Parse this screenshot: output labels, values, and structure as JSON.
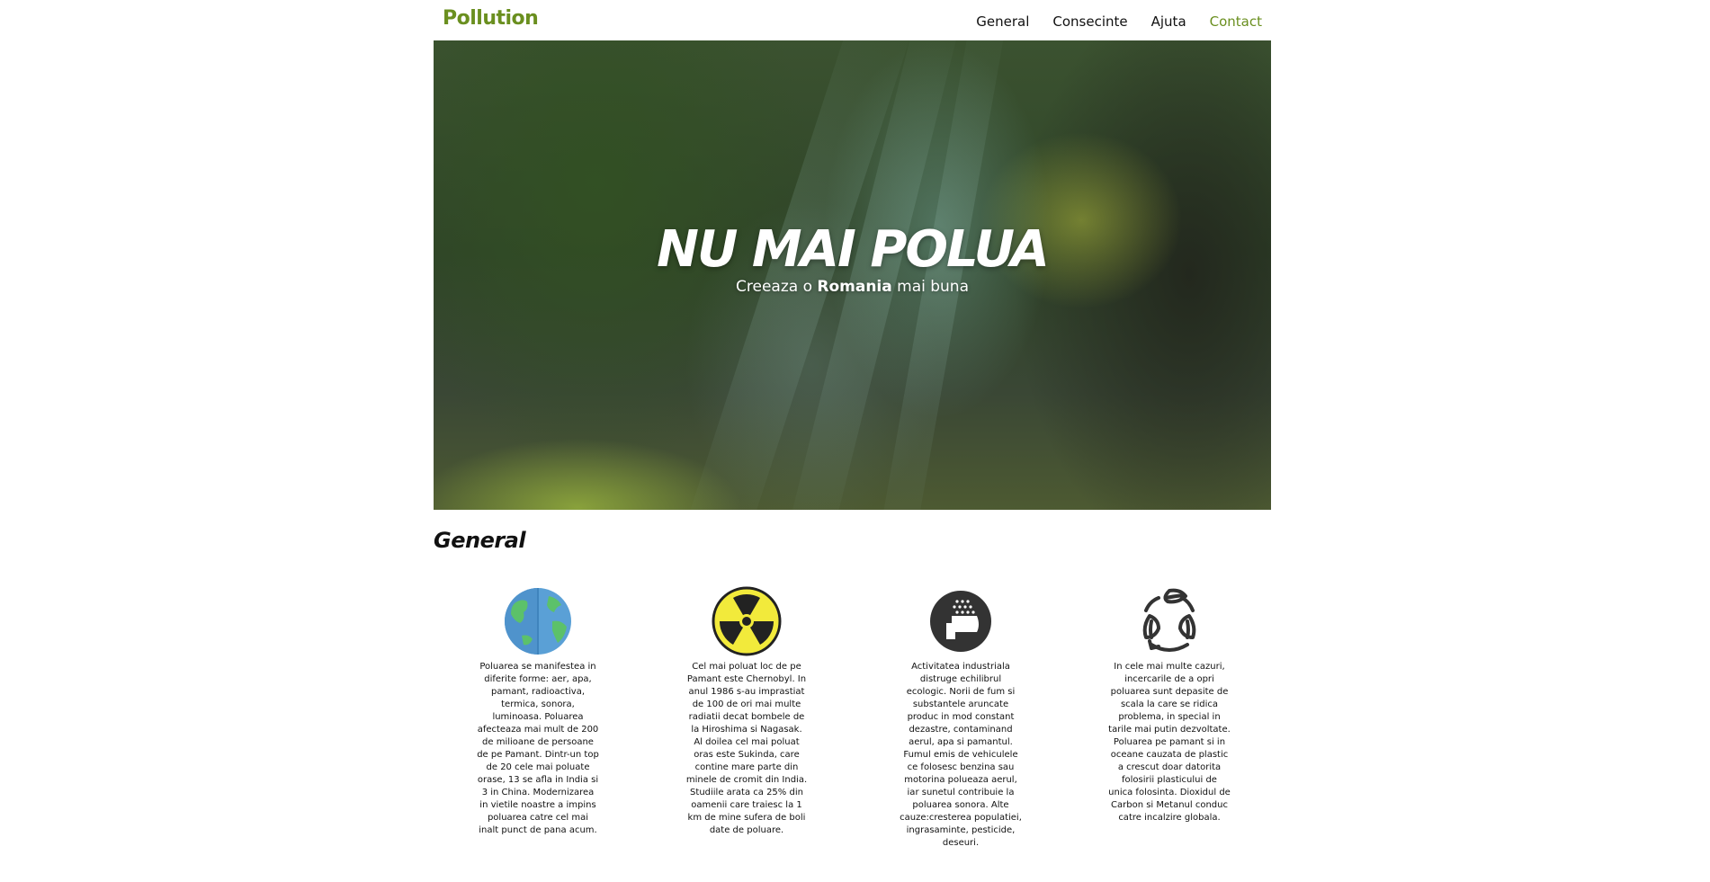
{
  "header": {
    "logo": "Pollution",
    "nav": [
      {
        "label": "General"
      },
      {
        "label": "Consecinte"
      },
      {
        "label": "Ajuta"
      },
      {
        "label": "Contact"
      }
    ]
  },
  "hero": {
    "title": "NU MAI POLUA",
    "subtitle_before": "Creeaza o ",
    "subtitle_bold": "Romania",
    "subtitle_after": " mai buna"
  },
  "general": {
    "title": "General",
    "items": [
      {
        "icon": "earth-globe-icon",
        "text": "Poluarea se manifestea in diferite forme: aer, apa, pamant, radioactiva, termica, sonora, luminoasa. Poluarea afecteaza mai mult de 200 de milioane de persoane de pe Pamant. Dintr-un top de 20 cele mai poluate orase, 13 se afla in India si 3 in China. Modernizarea in vietile noastre a impins poluarea catre cel mai inalt punct de pana acum."
      },
      {
        "icon": "radiation-icon",
        "text": "Cel mai poluat loc de pe Pamant este Chernobyl. In anul 1986 s-au imprastiat de 100 de ori mai multe radiatii decat bombele de la Hiroshima si Nagasak. Al doilea cel mai poluat oras este Sukinda, care contine mare parte din minele de cromit din India. Studiile arata ca 25% din oamenii care traiesc la 1 km de mine sufera de boli date de poluare."
      },
      {
        "icon": "factory-smoke-icon",
        "text": "Activitatea industriala distruge echilibrul ecologic. Norii de fum si substantele aruncate produc in mod constant dezastre, contaminand aerul, apa si pamantul. Fumul emis de vehiculele ce folosesc benzina sau motorina polueaza aerul, iar sunetul contribuie la poluarea sonora. Alte cauze:cresterea populatiei, ingrasaminte, pesticide, deseuri."
      },
      {
        "icon": "recycle-leaves-icon",
        "text": "In cele mai multe cazuri, incercarile de a opri poluarea sunt depasite de scala la care se ridica problema, in special in tarile mai putin dezvoltate. Poluarea pe pamant si in oceane cauzata de plastic a crescut doar datorita folosirii plasticului de unica folosinta. Dioxidul de Carbon si Metanul conduc catre incalzire globala."
      }
    ]
  },
  "colors": {
    "brand": "#6a8f1f",
    "text": "#111111",
    "globe_ocean": "#5aa0d6",
    "globe_land": "#5cc16a",
    "radiation_yellow": "#f2ea3b",
    "icon_dark": "#333333"
  }
}
